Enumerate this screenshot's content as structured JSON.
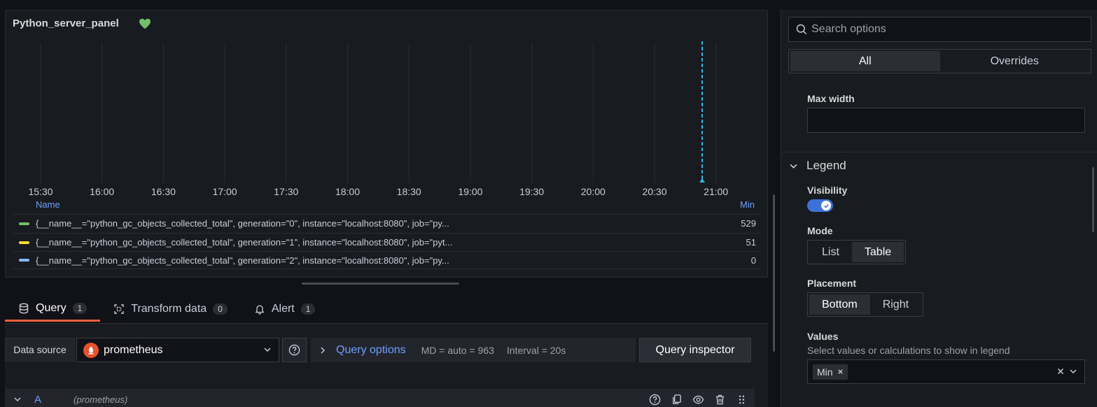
{
  "panel": {
    "title": "Python_server_panel",
    "status_icon": "heart-icon",
    "x_ticks": [
      "15:30",
      "16:00",
      "16:30",
      "17:00",
      "17:30",
      "18:00",
      "18:30",
      "19:00",
      "19:30",
      "20:00",
      "20:30",
      "21:00"
    ],
    "legend": {
      "name_header": "Name",
      "min_header": "Min",
      "rows": [
        {
          "label": "{__name__=\"python_gc_objects_collected_total\", generation=\"0\", instance=\"localhost:8080\", job=\"py...",
          "value": "529",
          "color": "#73bf69"
        },
        {
          "label": "{__name__=\"python_gc_objects_collected_total\", generation=\"1\", instance=\"localhost:8080\", job=\"pyt...",
          "value": "51",
          "color": "#fade2a"
        },
        {
          "label": "{__name__=\"python_gc_objects_collected_total\", generation=\"2\", instance=\"localhost:8080\", job=\"py...",
          "value": "0",
          "color": "#8ab8ff"
        }
      ]
    }
  },
  "tabs": [
    {
      "label": "Query",
      "count": "1",
      "icon": "database-icon"
    },
    {
      "label": "Transform data",
      "count": "0",
      "icon": "transform-icon"
    },
    {
      "label": "Alert",
      "count": "1",
      "icon": "bell-icon"
    }
  ],
  "query_editor": {
    "data_source_label": "Data source",
    "data_source_value": "prometheus",
    "query_options_label": "Query options",
    "md": "MD = auto = 963",
    "interval": "Interval = 20s",
    "query_inspector": "Query inspector",
    "row_letter": "A",
    "row_ds": "(prometheus)"
  },
  "options": {
    "search_placeholder": "Search options",
    "seg_all": "All",
    "seg_overrides": "Overrides",
    "max_width_label": "Max width",
    "legend_section": "Legend",
    "visibility_label": "Visibility",
    "mode_label": "Mode",
    "mode_list": "List",
    "mode_table": "Table",
    "placement_label": "Placement",
    "placement_bottom": "Bottom",
    "placement_right": "Right",
    "values_label": "Values",
    "values_desc": "Select values or calculations to show in legend",
    "values_chip": "Min"
  },
  "colors": {
    "accent": "#6e9fff",
    "tab_active": "#f55f3e",
    "toggle": "#3d71d9"
  }
}
